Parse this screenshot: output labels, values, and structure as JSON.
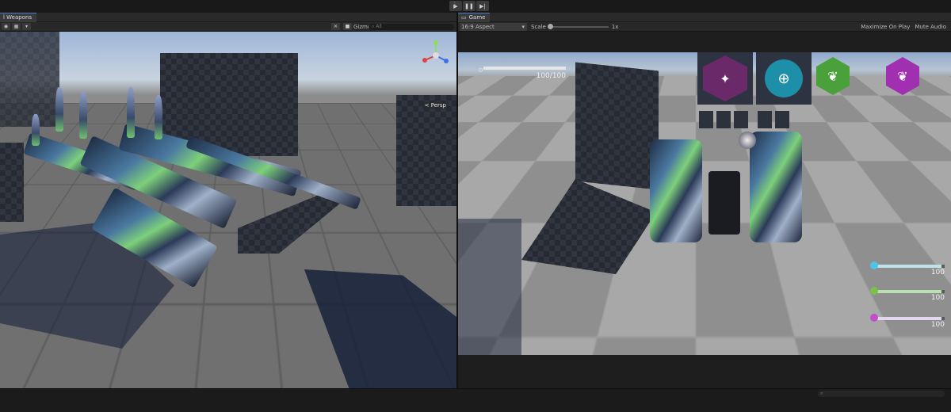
{
  "toolbar": {
    "play_icon": "play-icon",
    "pause_icon": "pause-icon",
    "step_icon": "step-icon"
  },
  "scene": {
    "tab_label": "l Weapons",
    "gizmos_label": "Gizmos",
    "search_placeholder": "All",
    "persp_label": "< Persp"
  },
  "game": {
    "tab_label": "Game",
    "aspect": "16:9 Aspect",
    "scale_label": "Scale",
    "scale_value": "1x",
    "maximize_label": "Maximize On Play",
    "mute_label": "Mute Audio",
    "health_text": "100/100",
    "health_fraction": 1.0,
    "ammo": [
      {
        "value": "100",
        "color": "#bfe3ea",
        "icon_color": "#4fc3e8",
        "icon": "crosshair-icon",
        "fraction": 0.95
      },
      {
        "value": "100",
        "color": "#b9e0b0",
        "icon_color": "#7bc04a",
        "icon": "green-gem-icon",
        "fraction": 0.95
      },
      {
        "value": "100",
        "color": "#e2d7ec",
        "icon_color": "#c050c8",
        "icon": "purple-gem-icon",
        "fraction": 0.95
      }
    ],
    "abilities": [
      {
        "name": "purple-emblem-icon",
        "bg": "#6a2a6a"
      },
      {
        "name": "cyan-target-icon",
        "bg": "#1e8fa8"
      },
      {
        "name": "green-hex-icon",
        "bg": "#4aa03a"
      },
      {
        "name": "purple-hex-icon",
        "bg": "#a030b0"
      }
    ]
  }
}
